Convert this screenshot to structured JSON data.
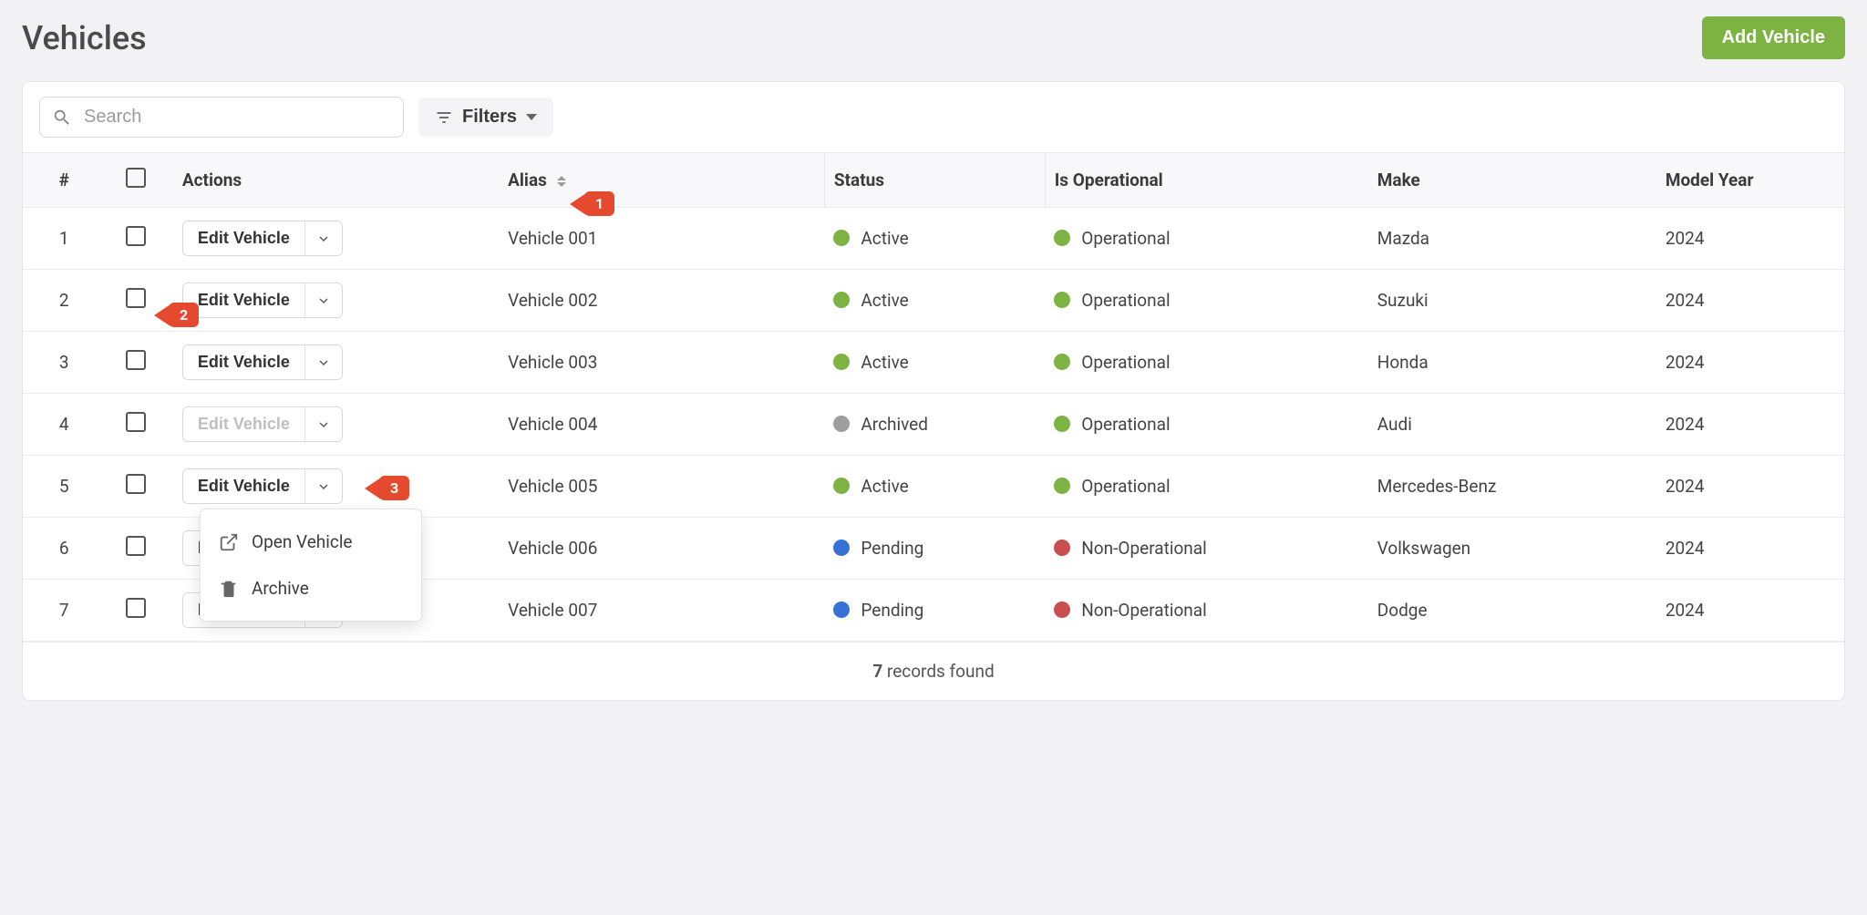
{
  "page": {
    "title": "Vehicles",
    "add_button": "Add Vehicle"
  },
  "toolbar": {
    "search_placeholder": "Search",
    "filters_label": "Filters"
  },
  "callouts": {
    "c1": "1",
    "c2": "2",
    "c3": "3"
  },
  "columns": {
    "num": "#",
    "actions": "Actions",
    "alias": "Alias",
    "status": "Status",
    "is_operational": "Is Operational",
    "make": "Make",
    "model_year": "Model Year"
  },
  "action_labels": {
    "edit_vehicle": "Edit Vehicle"
  },
  "dropdown": {
    "open_vehicle": "Open Vehicle",
    "archive": "Archive"
  },
  "rows": [
    {
      "num": "1",
      "alias": "Vehicle 001",
      "status": "Active",
      "status_color": "green",
      "oper": "Operational",
      "oper_color": "green",
      "make": "Mazda",
      "year": "2024",
      "disabled": false
    },
    {
      "num": "2",
      "alias": "Vehicle 002",
      "status": "Active",
      "status_color": "green",
      "oper": "Operational",
      "oper_color": "green",
      "make": "Suzuki",
      "year": "2024",
      "disabled": false
    },
    {
      "num": "3",
      "alias": "Vehicle 003",
      "status": "Active",
      "status_color": "green",
      "oper": "Operational",
      "oper_color": "green",
      "make": "Honda",
      "year": "2024",
      "disabled": false
    },
    {
      "num": "4",
      "alias": "Vehicle 004",
      "status": "Archived",
      "status_color": "gray",
      "oper": "Operational",
      "oper_color": "green",
      "make": "Audi",
      "year": "2024",
      "disabled": true
    },
    {
      "num": "5",
      "alias": "Vehicle 005",
      "status": "Active",
      "status_color": "green",
      "oper": "Operational",
      "oper_color": "green",
      "make": "Mercedes-Benz",
      "year": "2024",
      "disabled": false
    },
    {
      "num": "6",
      "alias": "Vehicle 006",
      "status": "Pending",
      "status_color": "blue",
      "oper": "Non-Operational",
      "oper_color": "red",
      "make": "Volkswagen",
      "year": "2024",
      "disabled": false
    },
    {
      "num": "7",
      "alias": "Vehicle 007",
      "status": "Pending",
      "status_color": "blue",
      "oper": "Non-Operational",
      "oper_color": "red",
      "make": "Dodge",
      "year": "2024",
      "disabled": false
    }
  ],
  "footer": {
    "count": "7",
    "records_found": " records found"
  }
}
